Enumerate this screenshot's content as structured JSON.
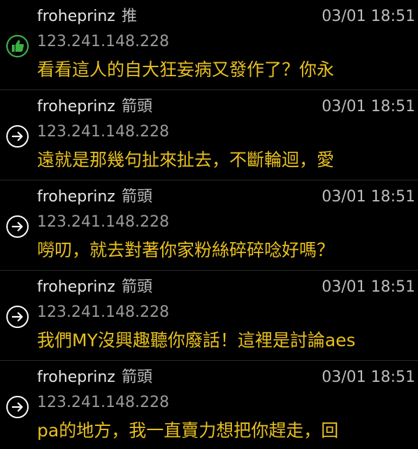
{
  "comments": [
    {
      "username": "froheprinz",
      "tag": "推",
      "icon": "thumbs-up-icon",
      "timestamp": "03/01 18:51",
      "ip": "123.241.148.228",
      "text": "看看這人的自大狂妄病又發作了？你永"
    },
    {
      "username": "froheprinz",
      "tag": "箭頭",
      "icon": "arrow-right-circle-icon",
      "timestamp": "03/01 18:51",
      "ip": "123.241.148.228",
      "text": "遠就是那幾句扯來扯去，不斷輪迴，愛"
    },
    {
      "username": "froheprinz",
      "tag": "箭頭",
      "icon": "arrow-right-circle-icon",
      "timestamp": "03/01 18:51",
      "ip": "123.241.148.228",
      "text": "嘮叨，就去對著你家粉絲碎碎唸好嗎？"
    },
    {
      "username": "froheprinz",
      "tag": "箭頭",
      "icon": "arrow-right-circle-icon",
      "timestamp": "03/01 18:51",
      "ip": "123.241.148.228",
      "text": "我們MY沒興趣聽你廢話！這裡是討論aes"
    },
    {
      "username": "froheprinz",
      "tag": "箭頭",
      "icon": "arrow-right-circle-icon",
      "timestamp": "03/01 18:51",
      "ip": "123.241.148.228",
      "text": "pa的地方，我一直賣力想把你趕走，回"
    }
  ],
  "colors": {
    "background": "#000000",
    "push_green": "#3cb043",
    "comment_text": "#e8c020",
    "separator": "#2a2a2a"
  }
}
